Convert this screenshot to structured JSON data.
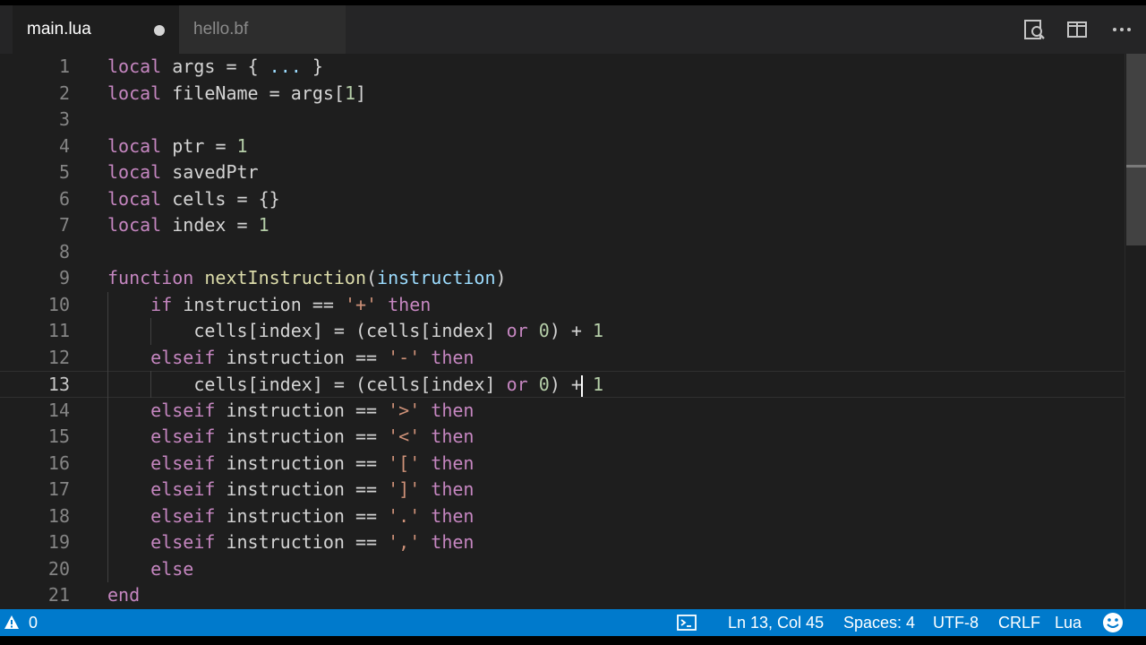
{
  "tabs": [
    {
      "label": "main.lua",
      "active": true,
      "dirty": true
    },
    {
      "label": "hello.bf",
      "active": false,
      "dirty": false
    }
  ],
  "editor_actions": [
    "open-changes-icon",
    "split-editor-icon",
    "more-actions-icon"
  ],
  "editor": {
    "language": "lua",
    "current_line": 13,
    "lines": [
      {
        "n": "1",
        "text": "local args = { ... }"
      },
      {
        "n": "2",
        "text": "local fileName = args[1]"
      },
      {
        "n": "3",
        "text": ""
      },
      {
        "n": "4",
        "text": "local ptr = 1"
      },
      {
        "n": "5",
        "text": "local savedPtr"
      },
      {
        "n": "6",
        "text": "local cells = {}"
      },
      {
        "n": "7",
        "text": "local index = 1"
      },
      {
        "n": "8",
        "text": ""
      },
      {
        "n": "9",
        "text": "function nextInstruction(instruction)"
      },
      {
        "n": "10",
        "text": "    if instruction == '+' then"
      },
      {
        "n": "11",
        "text": "        cells[index] = (cells[index] or 0) + 1"
      },
      {
        "n": "12",
        "text": "    elseif instruction == '-' then"
      },
      {
        "n": "13",
        "text": "        cells[index] = (cells[index] or 0) + 1"
      },
      {
        "n": "14",
        "text": "    elseif instruction == '>' then"
      },
      {
        "n": "15",
        "text": "    elseif instruction == '<' then"
      },
      {
        "n": "16",
        "text": "    elseif instruction == '[' then"
      },
      {
        "n": "17",
        "text": "    elseif instruction == ']' then"
      },
      {
        "n": "18",
        "text": "    elseif instruction == '.' then"
      },
      {
        "n": "19",
        "text": "    elseif instruction == ',' then"
      },
      {
        "n": "20",
        "text": "    else"
      },
      {
        "n": "21",
        "text": "end"
      }
    ]
  },
  "statusbar": {
    "warnings_count": "0",
    "cursor_position": "Ln 13, Col 45",
    "indentation": "Spaces: 4",
    "encoding": "UTF-8",
    "line_ending": "CRLF",
    "language_mode": "Lua"
  },
  "colors": {
    "accent": "#007acc",
    "background": "#1e1e1e",
    "keyword": "#c586c0",
    "function": "#dcdcaa",
    "parameter": "#9cdcfe",
    "number": "#b5cea8",
    "string": "#ce9178"
  }
}
